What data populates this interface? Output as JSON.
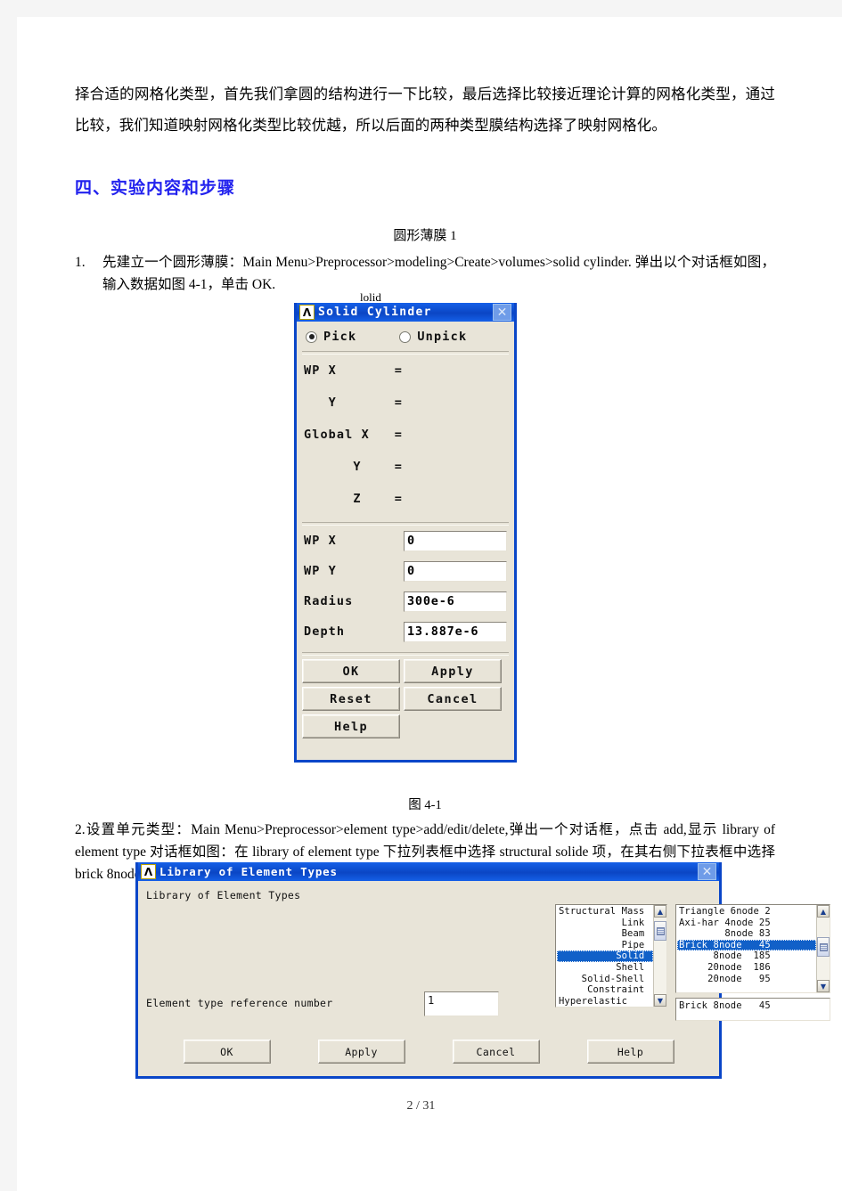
{
  "document": {
    "paragraphs": {
      "intro": "择合适的网格化类型，首先我们拿圆的结构进行一下比较，最后选择比较接近理论计算的网格化类型，通过比较，我们知道映射网格化类型比较优越，所以后面的两种类型膜结构选择了映射网格化。",
      "section_heading": "四、实验内容和步骤",
      "subsection_caption": "圆形薄膜 1",
      "step1_marker": "1.",
      "step1_text": "先建立一个圆形薄膜：Main Menu>Preprocessor>modeling>Create>volumes>solid cylinder. 弹出以个对话框如图，输入数据如图 4-1，单击 OK.",
      "figure1_label": "图 4-1",
      "step2_text": "2.设置单元类型：Main Menu>Preprocessor>element type>add/edit/delete,弹出一个对话框，点击 add,显示 library of element type 对话框如图：在 library of element type 下拉列表框中选择 structural solide 项，在其右侧下拉表框中选择 brick 8node 45 选项，单击 OK. 在点击 close.如图 4-2.",
      "obscured_fragment": "lolid"
    },
    "footer": "2 / 31"
  },
  "solid_cylinder_dialog": {
    "title": "Solid Cylinder",
    "logo": "Λ",
    "close_icon": "✕",
    "pick_label": "Pick",
    "unpick_label": "Unpick",
    "pick_selected": true,
    "readonly_rows": [
      {
        "label": "WP X",
        "eq": "="
      },
      {
        "label": "   Y",
        "eq": "="
      },
      {
        "label": "Global X",
        "eq": "="
      },
      {
        "label": "      Y",
        "eq": "="
      },
      {
        "label": "      Z",
        "eq": "="
      }
    ],
    "fields": [
      {
        "label": "WP X",
        "value": "0"
      },
      {
        "label": "WP Y",
        "value": "0"
      },
      {
        "label": "Radius",
        "value": "300e-6"
      },
      {
        "label": "Depth",
        "value": "13.887e-6"
      }
    ],
    "buttons": [
      "OK",
      "Apply",
      "Reset",
      "Cancel",
      "Help"
    ]
  },
  "library_dialog": {
    "title": "Library of Element Types",
    "logo": "Λ",
    "close_icon": "✕",
    "group_label": "Library of Element Types",
    "left_list": [
      "Structural Mass",
      "           Link",
      "           Beam",
      "           Pipe",
      "          Solid",
      "          Shell",
      "    Solid-Shell",
      "     Constraint",
      "Hyperelastic"
    ],
    "left_selected_index": 4,
    "right_list": [
      "Triangle 6node 2",
      "Axi-har 4node 25",
      "        8node 83",
      "Brick 8node   45",
      "      8node  185",
      "     20node  186",
      "     20node   95"
    ],
    "right_selected_index": 3,
    "selected_value": "Brick 8node   45",
    "ref_number_label": "Element type reference number",
    "ref_number_value": "1",
    "buttons": [
      "OK",
      "Apply",
      "Cancel",
      "Help"
    ],
    "scroll_up_icon": "▲",
    "scroll_down_icon": "▼"
  },
  "colors": {
    "heading": "#2222ee",
    "title_bar": "#0b46c4",
    "dialog_face": "#e8e4d8",
    "selection": "#1160c8"
  }
}
